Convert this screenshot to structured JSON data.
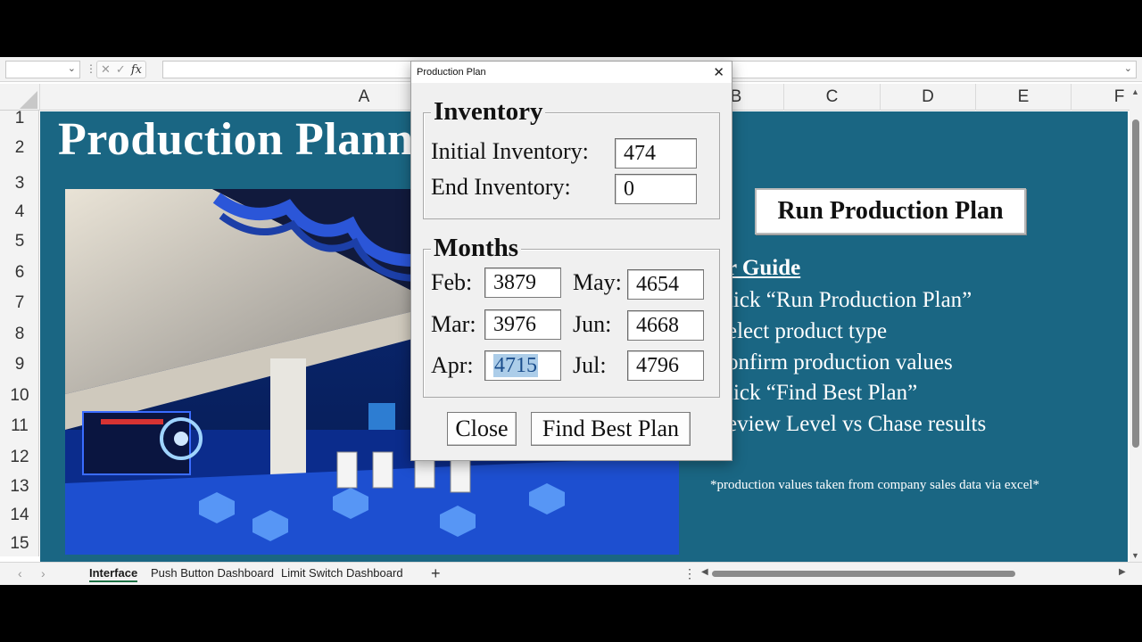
{
  "formula_bar": {
    "name_box_value": "",
    "formula_value": "",
    "fx_label": "fx"
  },
  "columns": [
    "A",
    "B",
    "C",
    "D",
    "E",
    "F"
  ],
  "rows": [
    "1",
    "2",
    "3",
    "4",
    "5",
    "6",
    "7",
    "8",
    "9",
    "10",
    "11",
    "12",
    "13",
    "14",
    "15"
  ],
  "sheet": {
    "title": "Production Plann",
    "image_icon": "server-room-photo",
    "run_button_label": "Run Production Plan",
    "guide_title": "r Guide",
    "guide_steps": [
      "lick “Run Production Plan”",
      "elect product type",
      "onfirm production values",
      "lick “Find Best Plan”",
      "eview Level vs Chase results"
    ],
    "note": "*production values taken from company sales data via excel*"
  },
  "dialog": {
    "title": "Production Plan",
    "inventory_group_label": "Inventory",
    "initial_inventory_label": "Initial Inventory:",
    "initial_inventory_value": "474",
    "end_inventory_label": "End Inventory:",
    "end_inventory_value": "0",
    "months_group_label": "Months",
    "months": {
      "feb_label": "Feb:",
      "feb_value": "3879",
      "mar_label": "Mar:",
      "mar_value": "3976",
      "apr_label": "Apr:",
      "apr_value": "4715",
      "may_label": "May:",
      "may_value": "4654",
      "jun_label": "Jun:",
      "jun_value": "4668",
      "jul_label": "Jul:",
      "jul_value": "4796"
    },
    "close_label": "Close",
    "find_label": "Find Best Plan"
  },
  "tabs": [
    "Interface",
    "Push Button Dashboard",
    "Limit Switch Dashboard"
  ],
  "active_tab": "Interface",
  "colors": {
    "sheet_bg": "#1a6683",
    "accent_green": "#1e7145",
    "selection": "#accde9"
  }
}
